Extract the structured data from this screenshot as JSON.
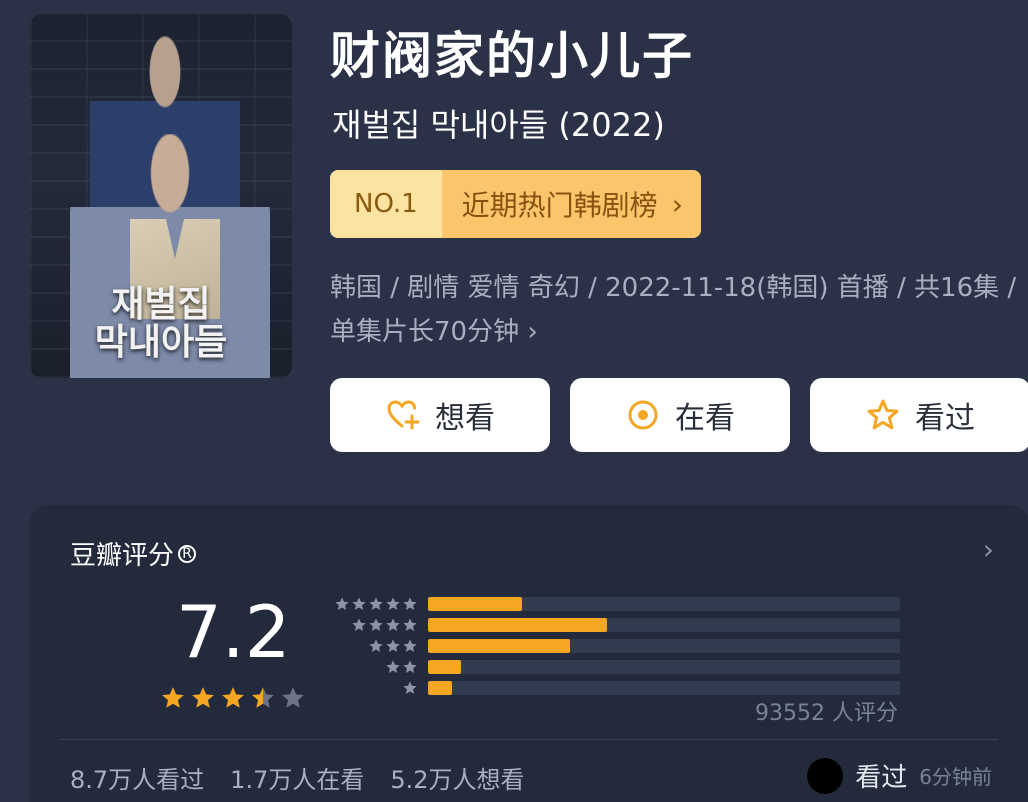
{
  "title": "财阀家的小儿子",
  "subtitle": "재벌집 막내아들 (2022)",
  "poster": {
    "title_line1": "재벌집",
    "title_line2": "막내아들"
  },
  "ranking": {
    "rank": "NO.1",
    "list_name": "近期热门韩剧榜",
    "chevron": "›"
  },
  "meta": {
    "text": "韩国 / 剧情 爱情 奇幻 / 2022-11-18(韩国) 首播 / 共16集 / 单集片长70分钟 ›"
  },
  "actions": [
    {
      "label": "想看",
      "icon": "heart-plus-icon"
    },
    {
      "label": "在看",
      "icon": "target-circle-icon"
    },
    {
      "label": "看过",
      "icon": "star-outline-icon"
    }
  ],
  "rating": {
    "header": "豆瓣评分",
    "registered_mark": "R",
    "arrow": "›",
    "score": "7.2",
    "stars_value": 3.5,
    "distribution": [
      {
        "stars": 5,
        "fraction": 0.2
      },
      {
        "stars": 4,
        "fraction": 0.38
      },
      {
        "stars": 3,
        "fraction": 0.3
      },
      {
        "stars": 2,
        "fraction": 0.07
      },
      {
        "stars": 1,
        "fraction": 0.05
      }
    ],
    "votes": "93552 人评分"
  },
  "footer": {
    "watched": "8.7万人看过",
    "watching": "1.7万人在看",
    "want": "5.2万人想看",
    "friend_action": "看过",
    "friend_time": "6分钟前"
  },
  "colors": {
    "background": "#2b3247",
    "accent": "#f5a623",
    "rank_light": "#fde3a1",
    "rank_dark": "#fbc56b"
  }
}
